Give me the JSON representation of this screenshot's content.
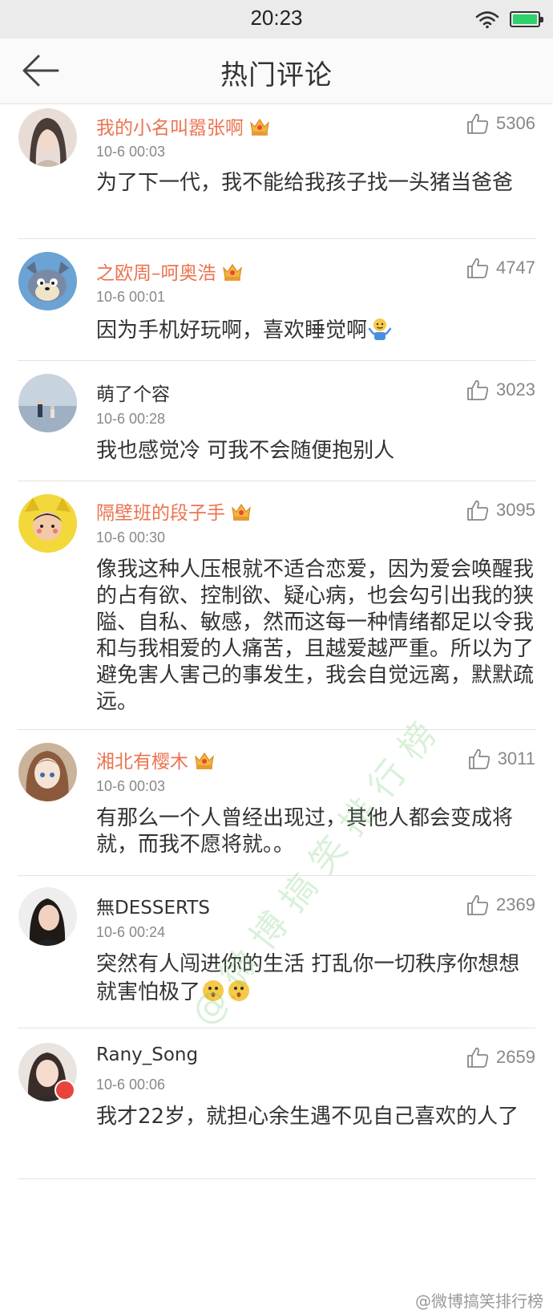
{
  "status_bar": {
    "time": "20:23"
  },
  "nav": {
    "title": "热门评论"
  },
  "comments": [
    {
      "username": "我的小名叫嚣张啊",
      "vip": true,
      "time": "10-6 00:03",
      "likes": "5306",
      "text": "为了下一代，我不能给我孩子找一头猪当爸爸",
      "avatar_color": "#d9c8c0"
    },
    {
      "username": "之欧周–呵奥浩",
      "vip": true,
      "time": "10-6 00:01",
      "likes": "4747",
      "text": "因为手机好玩啊，喜欢睡觉啊",
      "avatar_color": "#6aa3d4"
    },
    {
      "username": "萌了个容",
      "vip": false,
      "time": "10-6 00:28",
      "likes": "3023",
      "text": "我也感觉冷 可我不会随便抱别人",
      "avatar_color": "#b9c6d6"
    },
    {
      "username": "隔壁班的段子手",
      "vip": true,
      "time": "10-6 00:30",
      "likes": "3095",
      "text": "像我这种人压根就不适合恋爱，因为爱会唤醒我的占有欲、控制欲、疑心病，也会勾引出我的狭隘、自私、敏感，然而这每一种情绪都足以令我和与我相爱的人痛苦，且越爱越严重。所以为了避免害人害己的事发生，我会自觉远离，默默疏远。",
      "avatar_color": "#f2d83a"
    },
    {
      "username": "湘北有樱木",
      "vip": true,
      "time": "10-6 00:03",
      "likes": "3011",
      "text": "有那么一个人曾经出现过，其他人都会变成将就，而我不愿将就。。",
      "avatar_color": "#a9805e"
    },
    {
      "username": "無DESSERTS",
      "vip": false,
      "time": "10-6 00:24",
      "likes": "2369",
      "text": "突然有人闯进你的生活 打乱你一切秩序你想想就害怕极了",
      "avatar_color": "#3a3330"
    },
    {
      "username": "Rany_Song",
      "vip": false,
      "time": "10-6 00:06",
      "likes": "2659",
      "text": "我才22岁，就担心余生遇不见自己喜欢的人了",
      "avatar_color": "#4a3a34"
    }
  ],
  "watermark": "@微博搞笑排行榜",
  "footer_watermark": "@微博搞笑排行榜",
  "colors": {
    "vip_name": "#eb7350",
    "battery": "#2fd16a"
  }
}
